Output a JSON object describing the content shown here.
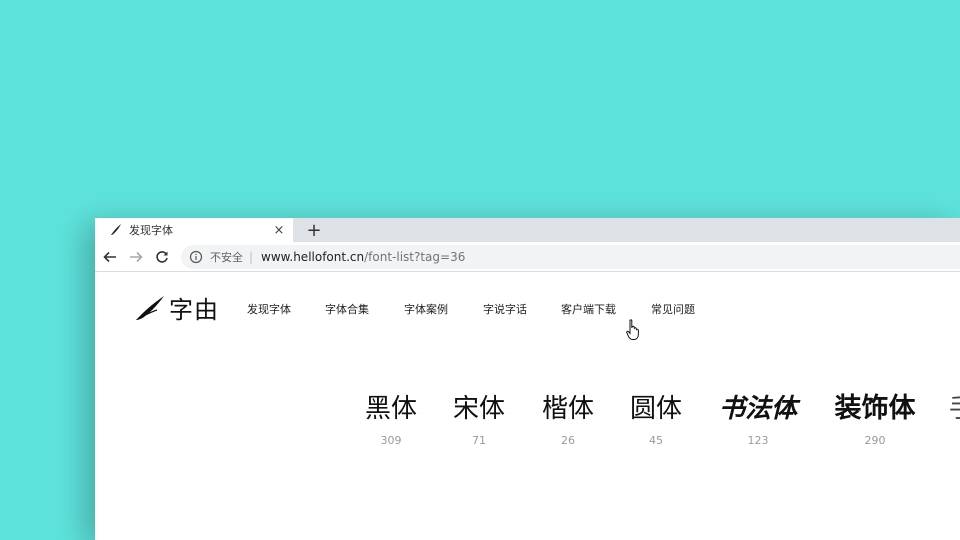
{
  "browser": {
    "tab": {
      "title": "发现字体",
      "close_glyph": "×"
    },
    "new_tab_glyph": "+",
    "address_bar": {
      "security_label": "不安全",
      "separator": "|",
      "url_host": "www.hellofont.cn",
      "url_path": "/font-list?tag=36"
    },
    "icons": {
      "back": "back-arrow-icon",
      "forward": "forward-arrow-icon",
      "reload": "reload-icon",
      "info": "info-icon"
    }
  },
  "site": {
    "logo_text": "字由",
    "nav": [
      {
        "label": "发现字体"
      },
      {
        "label": "字体合集"
      },
      {
        "label": "字体案例"
      },
      {
        "label": "字说字话"
      },
      {
        "label": "客户端下载"
      },
      {
        "label": "常见问题"
      }
    ]
  },
  "font_categories": [
    {
      "name": "黑体",
      "count": "309"
    },
    {
      "name": "宋体",
      "count": "71"
    },
    {
      "name": "楷体",
      "count": "26"
    },
    {
      "name": "圆体",
      "count": "45"
    },
    {
      "name": "书法体",
      "count": "123"
    },
    {
      "name": "装饰体",
      "count": "290"
    },
    {
      "name": "手",
      "count": ""
    }
  ],
  "colors": {
    "background": "#5ee3dc",
    "tabbar": "#dee1e6",
    "omnibox": "#f1f3f4",
    "count_text": "#9a9a9a"
  }
}
